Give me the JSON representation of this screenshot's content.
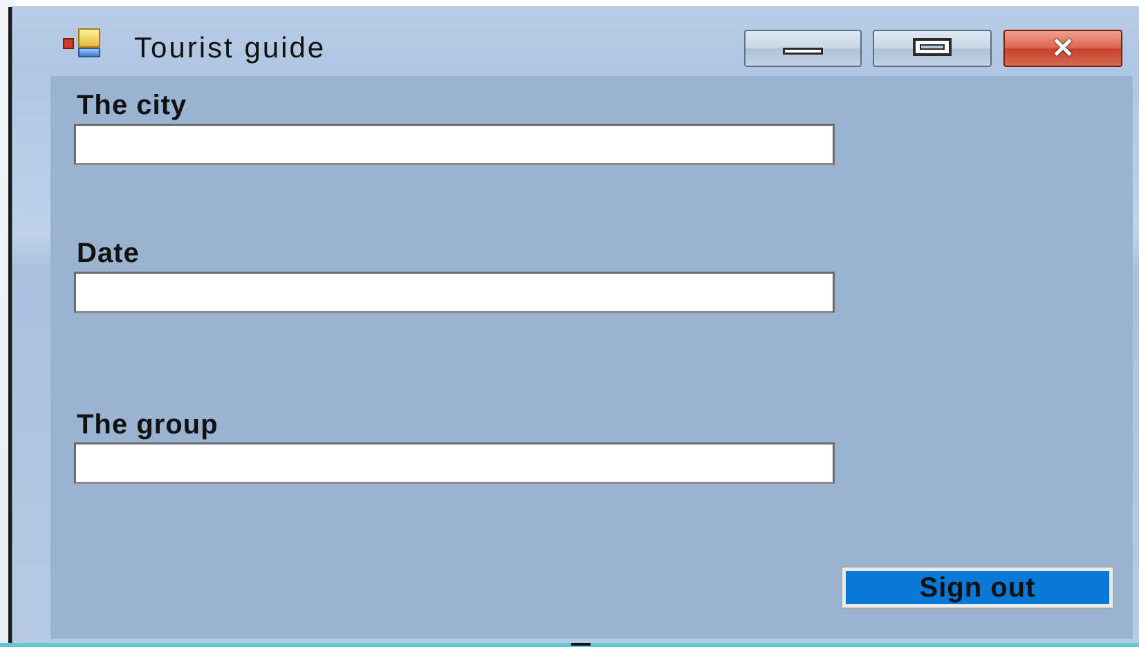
{
  "window": {
    "title": "Tourist guide",
    "close_symbol": "✕",
    "icon": "app-form-icon"
  },
  "form": {
    "city_label": "The city",
    "city_value": "",
    "date_label": "Date",
    "date_value": "",
    "group_label": "The group",
    "group_value": "",
    "signout_label": "Sign out"
  },
  "colors": {
    "client_background": "#99b3d1",
    "signout_button": "#0a78d7",
    "close_button": "#c8412b"
  }
}
